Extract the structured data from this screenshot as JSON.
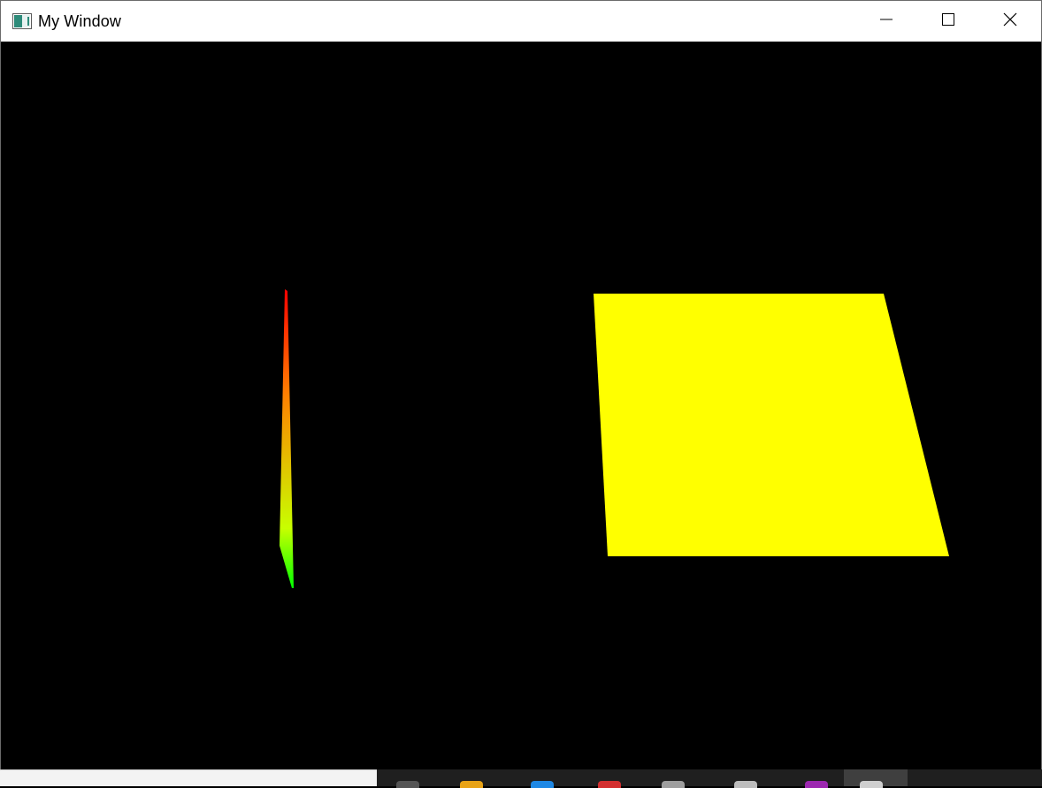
{
  "window": {
    "title": "My Window",
    "icon": "app-window-icon",
    "controls": {
      "minimize_icon": "minimize-icon",
      "maximize_icon": "maximize-icon",
      "close_icon": "close-icon"
    }
  },
  "scene": {
    "background": "#000000",
    "gradient_shape": {
      "colors": [
        "#ff0000",
        "#ff7f00",
        "#c8ff00",
        "#00ff00"
      ]
    },
    "yellow_quad": {
      "color": "#ffff00"
    }
  },
  "taskbar": {
    "background": "#1f1f1f",
    "search_box_color": "#f3f3f3",
    "icons": [
      {
        "name": "taskbar-icon-1",
        "color": "#555555"
      },
      {
        "name": "taskbar-icon-2",
        "color": "#e8a317"
      },
      {
        "name": "taskbar-icon-3",
        "color": "#1e88e5"
      },
      {
        "name": "taskbar-icon-4",
        "color": "#d32f2f"
      },
      {
        "name": "taskbar-icon-5",
        "color": "#9e9e9e"
      },
      {
        "name": "taskbar-icon-6",
        "color": "#bdbdbd"
      },
      {
        "name": "taskbar-icon-7",
        "color": "#9c27b0"
      },
      {
        "name": "taskbar-icon-8",
        "color": "#cfcfcf"
      }
    ]
  }
}
